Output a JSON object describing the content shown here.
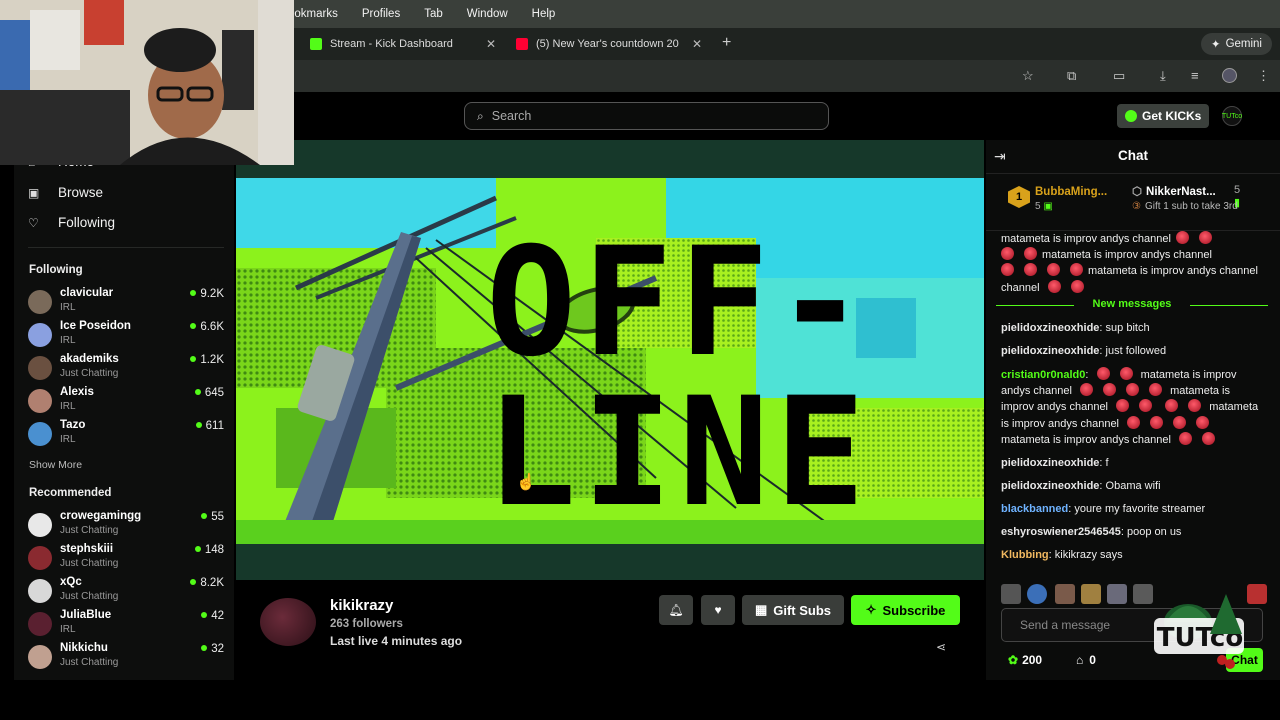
{
  "menubar": {
    "items": [
      "ookmarks",
      "Profiles",
      "Tab",
      "Window",
      "Help"
    ]
  },
  "tabs": [
    {
      "title": "Stream - Kick Dashboard",
      "favicon_color": "#53fc18"
    },
    {
      "title": "(5) New Year's countdown 20",
      "favicon_color": "#ff0033"
    }
  ],
  "gemini_label": "Gemini",
  "search": {
    "placeholder": "Search"
  },
  "header": {
    "get_kicks": "Get KICKs",
    "avatar_text": "TUTco"
  },
  "sidebar": {
    "nav": [
      {
        "label": "Home",
        "icon": "home-icon"
      },
      {
        "label": "Browse",
        "icon": "browse-icon"
      },
      {
        "label": "Following",
        "icon": "heart-icon"
      }
    ],
    "following_title": "Following",
    "following": [
      {
        "name": "clavicular",
        "category": "IRL",
        "viewers": "9.2K",
        "avatar": "#7a6a5a"
      },
      {
        "name": "Ice Poseidon",
        "category": "IRL",
        "viewers": "6.6K",
        "avatar": "#8aa0e0"
      },
      {
        "name": "akademiks",
        "category": "Just Chatting",
        "viewers": "1.2K",
        "avatar": "#6a5040"
      },
      {
        "name": "Alexis",
        "category": "IRL",
        "viewers": "645",
        "avatar": "#b08070"
      },
      {
        "name": "Tazo",
        "category": "IRL",
        "viewers": "611",
        "avatar": "#4a90d0"
      }
    ],
    "show_more": "Show More",
    "recommended_title": "Recommended",
    "recommended": [
      {
        "name": "crowegamingg",
        "category": "Just Chatting",
        "viewers": "55",
        "avatar": "#e8e8e8"
      },
      {
        "name": "stephskiii",
        "category": "Just Chatting",
        "viewers": "148",
        "avatar": "#8a2a30"
      },
      {
        "name": "xQc",
        "category": "Just Chatting",
        "viewers": "8.2K",
        "avatar": "#d8d8d8"
      },
      {
        "name": "JuliaBlue",
        "category": "IRL",
        "viewers": "42",
        "avatar": "#5a2030"
      },
      {
        "name": "Nikkichu",
        "category": "Just Chatting",
        "viewers": "32",
        "avatar": "#c0a090"
      }
    ]
  },
  "video": {
    "offline_line1": "OFF-",
    "offline_line2": "LINE"
  },
  "channel": {
    "name": "kikikrazy",
    "followers": "263 followers",
    "last_live": "Last live 4 minutes ago",
    "gift_label": "Gift Subs",
    "subscribe_label": "Subscribe"
  },
  "chat": {
    "title": "Chat",
    "leaderboard": {
      "first_rank": "1",
      "first_name": "BubbaMing...",
      "first_count": "5",
      "second_name": "NikkerNast...",
      "second_count": "5",
      "second_gift_text": "Gift 1 sub to take 3rd"
    },
    "old_messages": [
      {
        "text": "matameta is improv andys channel"
      },
      {
        "text": "matameta is improv andys channel"
      },
      {
        "text": "matameta is improv andys channel"
      }
    ],
    "new_messages_label": "New messages",
    "messages": [
      {
        "user": "pielidoxzineoxhide",
        "color": "#e8e8e8",
        "text": "sup bitch"
      },
      {
        "user": "pielidoxzineoxhide",
        "color": "#e8e8e8",
        "text": "just followed"
      },
      {
        "user": "cristian0r0nald0",
        "color": "#53fc18",
        "text": "matameta is improv andys channel",
        "emotes": true
      },
      {
        "user": "pielidoxzineoxhide",
        "color": "#e8e8e8",
        "text": "f"
      },
      {
        "user": "pielidoxzineoxhide",
        "color": "#e8e8e8",
        "text": "Obama wifi"
      },
      {
        "user": "blackbanned",
        "color": "#6fb3ff",
        "text": "youre my favorite streamer"
      },
      {
        "user": "eshyroswiener2546545",
        "color": "#e8e8e8",
        "text": "poop on us"
      },
      {
        "user": "Klubbing",
        "color": "#f0b860",
        "text": "kikikrazy says"
      }
    ],
    "input_placeholder": "Send a message",
    "points": "200",
    "wallet": "0",
    "send_label": "Chat"
  },
  "colors": {
    "accent": "#53fc18",
    "background": "#000000"
  }
}
